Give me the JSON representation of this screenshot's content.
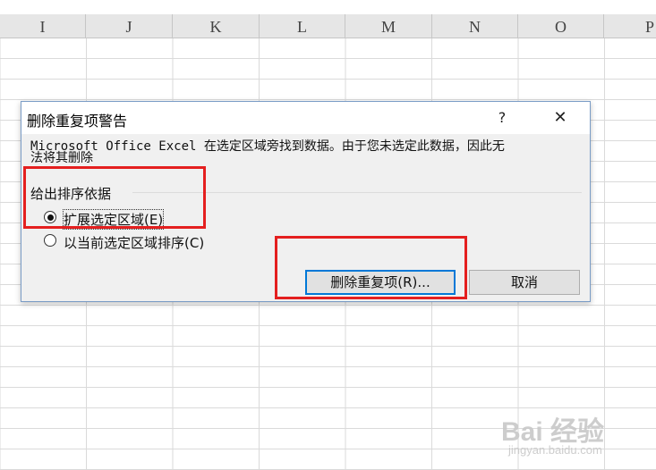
{
  "sheet": {
    "columns": [
      "I",
      "J",
      "K",
      "L",
      "M",
      "N",
      "O",
      "P"
    ]
  },
  "dialog": {
    "title": "删除重复项警告",
    "help_label": "?",
    "close_label": "✕",
    "message_line1": "Microsoft Office Excel 在选定区域旁找到数据。由于您未选定此数据，因此无",
    "message_line2": "法将其删除",
    "group_label": "给出排序依据",
    "options": [
      {
        "label": "扩展选定区域(E)",
        "checked": true
      },
      {
        "label": "以当前选定区域排序(C)",
        "checked": false
      }
    ],
    "remove_button": "删除重复项(R)...",
    "cancel_button": "取消"
  },
  "annotation_color": "#e41f1f",
  "watermark": {
    "logo": "Bai 经验",
    "url": "jingyan.baidu.com"
  }
}
